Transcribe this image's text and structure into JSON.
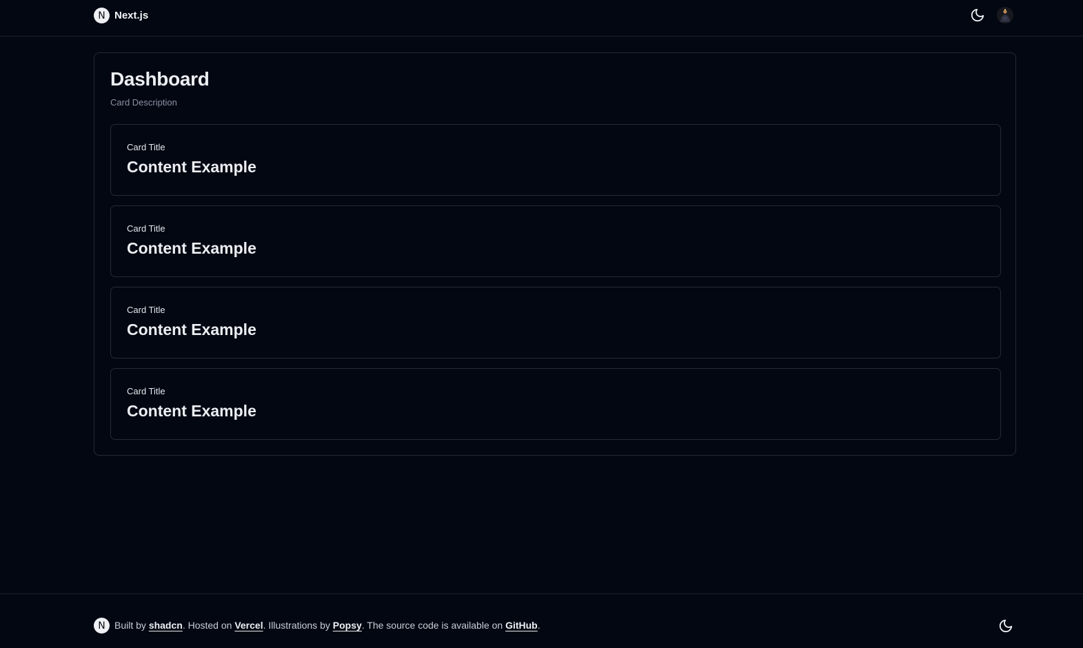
{
  "header": {
    "brand_name": "Next.js",
    "logo_letter": "N",
    "theme_toggle_icon": "moon-icon",
    "avatar": "user-avatar"
  },
  "dashboard": {
    "title": "Dashboard",
    "description": "Card Description",
    "cards": [
      {
        "title": "Card Title",
        "content": "Content Example"
      },
      {
        "title": "Card Title",
        "content": "Content Example"
      },
      {
        "title": "Card Title",
        "content": "Content Example"
      },
      {
        "title": "Card Title",
        "content": "Content Example"
      }
    ]
  },
  "footer": {
    "logo_letter": "N",
    "text_built_by": "Built by ",
    "link_shadcn": "shadcn",
    "text_hosted_on": ". Hosted on ",
    "link_vercel": "Vercel",
    "text_illustrations_by": ". Illustrations by ",
    "link_popsy": "Popsy",
    "text_source": ". The source code is available on ",
    "link_github": "GitHub",
    "text_end": ".",
    "theme_toggle_icon": "moon-icon"
  },
  "colors": {
    "background": "#030712",
    "border": "#242a38",
    "foreground": "#eceef2",
    "muted": "#8a92a3"
  }
}
